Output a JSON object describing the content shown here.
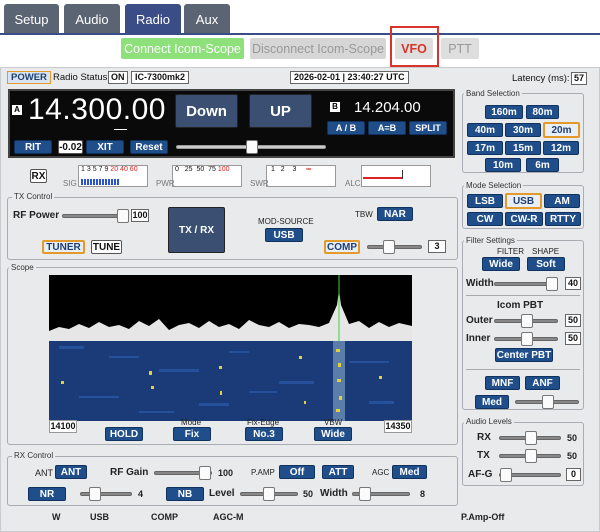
{
  "tabs": [
    {
      "label": "Setup"
    },
    {
      "label": "Audio"
    },
    {
      "label": "Radio"
    },
    {
      "label": "Aux"
    }
  ],
  "top_buttons": {
    "connect": "Connect Icom-Scope",
    "disconnect": "Disconnect Icom-Scope",
    "vfo": "VFO",
    "ptt": "PTT"
  },
  "status": {
    "power": "POWER",
    "radio_status_label": "Radio Status:",
    "radio_status": "ON",
    "model": "IC-7300mk2",
    "datetime": "2026-02-01 | 23:40:27 UTC",
    "latency_label": "Latency (ms):",
    "latency": "57"
  },
  "vfo": {
    "a_label": "A",
    "freq_a": "14.300.00",
    "down": "Down",
    "up": "UP",
    "b_label": "B",
    "freq_b": "14.204.00",
    "ab": "A / B",
    "aeqb": "A=B",
    "split": "SPLIT",
    "rit": "RIT",
    "rit_value": "-0.02",
    "xit": "XIT",
    "reset": "Reset",
    "rit_slider": 0.5
  },
  "meters": {
    "rx": "RX",
    "sig": "SIG",
    "sig_scale": [
      "1",
      "3",
      "5",
      "7",
      "9",
      "20",
      "40",
      "60"
    ],
    "pwr": "PWR",
    "pwr_scale": [
      "0",
      "25",
      "50",
      "75",
      "100"
    ],
    "swr": "SWR",
    "swr_scale": [
      "1",
      "2",
      "3",
      "∞"
    ],
    "alc": "ALC",
    "sig_level": 0.55
  },
  "tx": {
    "legend": "TX Control",
    "rf_power_label": "RF Power",
    "rf_power": "100",
    "rf_power_level": 1.0,
    "txrx": "TX / RX",
    "mod_source_label": "MOD-SOURCE",
    "mod_source": "USB",
    "tbw_label": "TBW",
    "tbw": "NAR",
    "tuner": "TUNER",
    "tune": "TUNE",
    "comp": "COMP",
    "comp_value": "3",
    "comp_level": 0.3
  },
  "bands": {
    "legend": "Band Selection",
    "items": [
      "160m",
      "80m",
      "40m",
      "30m",
      "20m",
      "17m",
      "15m",
      "12m",
      "10m",
      "6m"
    ],
    "selected": "20m"
  },
  "modes": {
    "legend": "Mode Selection",
    "items": [
      "LSB",
      "USB",
      "AM",
      "CW",
      "CW-R",
      "RTTY"
    ],
    "selected": "USB"
  },
  "filter": {
    "legend": "Filter Settings",
    "filter_label": "FILTER",
    "shape_label": "SHAPE",
    "filter": "Wide",
    "shape": "Soft",
    "width_label": "Width",
    "width": "40",
    "width_level": 1.0,
    "pbt_title": "Icom PBT",
    "outer_label": "Outer",
    "outer": "50",
    "inner_label": "Inner",
    "inner": "50",
    "center_pbt": "Center PBT",
    "mnf": "MNF",
    "anf": "ANF",
    "med": "Med"
  },
  "scope": {
    "legend": "Scope",
    "start": "14100",
    "end": "14350",
    "hold": "HOLD",
    "mode_label": "Mode",
    "mode": "Fix",
    "fixedge_label": "Fix-Edge",
    "fixedge": "No.3",
    "vbw_label": "VBW",
    "vbw": "Wide"
  },
  "audio": {
    "legend": "Audio Levels",
    "rx_label": "RX",
    "rx": "50",
    "tx_label": "TX",
    "tx": "50",
    "afg_label": "AF-G",
    "afg": "0"
  },
  "rx": {
    "legend": "RX Control",
    "ant_label": "ANT",
    "ant": "ANT",
    "rf_gain_label": "RF Gain",
    "rf_gain": "100",
    "pamp_label": "P.AMP",
    "pamp": "Off",
    "att": "ATT",
    "agc_label": "AGC",
    "agc": "Med",
    "nr": "NR",
    "nr_value": "4",
    "nb": "NB",
    "level_label": "Level",
    "level": "50",
    "width_label": "Width",
    "width": "8"
  },
  "bottom": {
    "w": "W",
    "mode": "USB",
    "comp": "COMP",
    "agc": "AGC-M",
    "pamp": "P.Amp-Off"
  }
}
